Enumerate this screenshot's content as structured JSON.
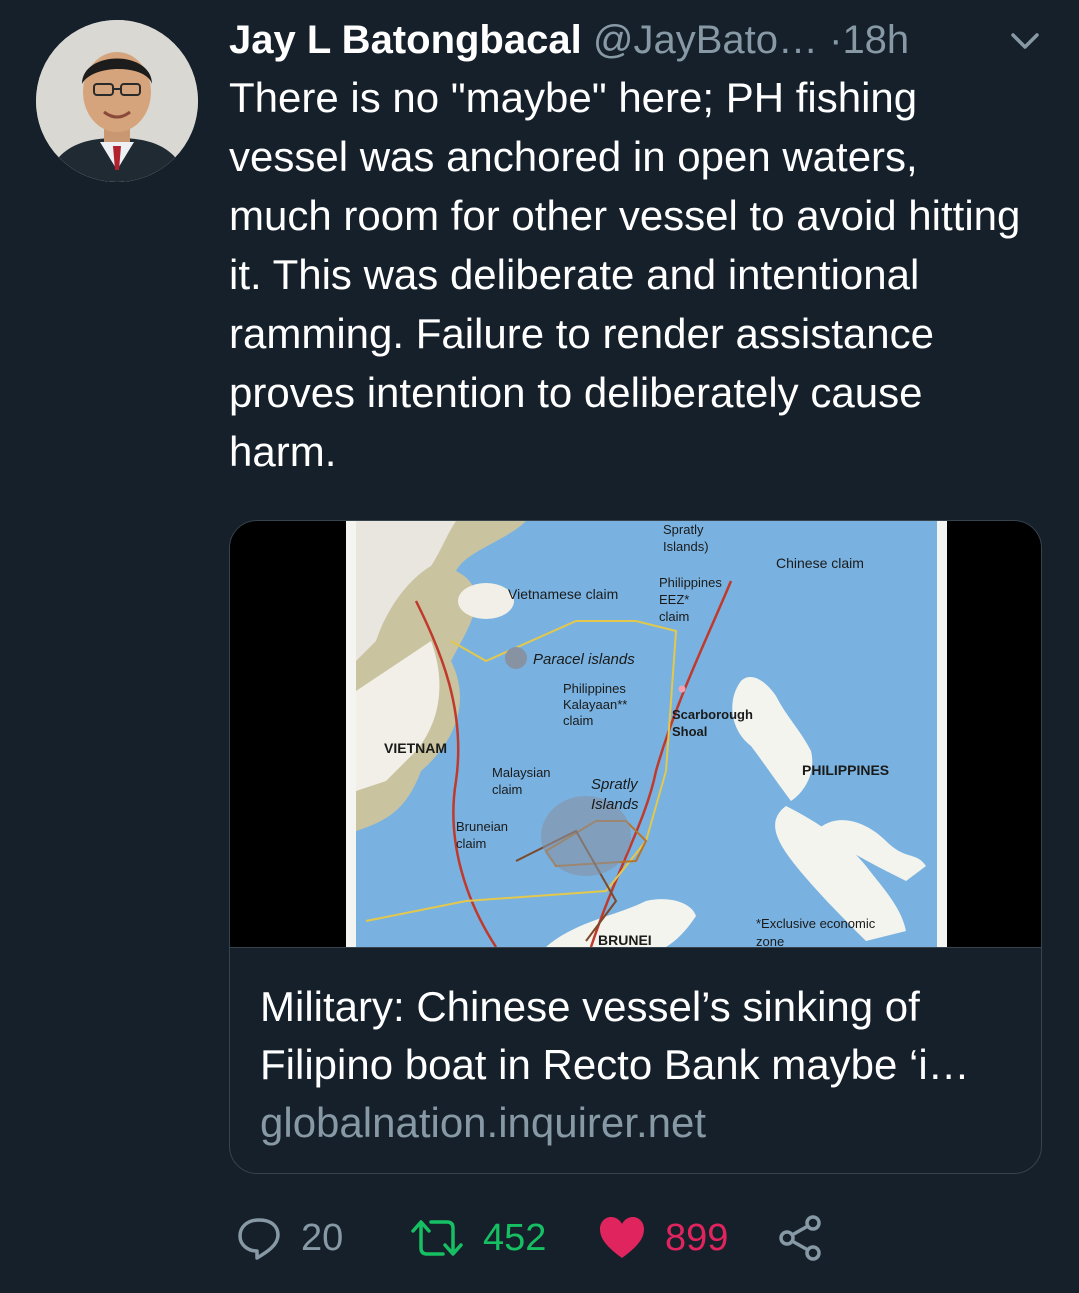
{
  "tweet": {
    "author_name": "Jay L Batongbacal",
    "author_handle": "@JayBato…",
    "separator": "·",
    "time": "18h",
    "text": "There is no \"maybe\" here; PH fishing vessel was anchored in open waters, much room for other vessel to avoid hitting it. This was deliberate and intentional ramming. Failure to render assistance proves intention to deliberately cause harm."
  },
  "card": {
    "title": "Military: Chinese vessel’s sinking of Filipino boat in Recto Bank maybe ‘i…",
    "domain": "globalnation.inquirer.net",
    "map": {
      "spratly_top": "Spratly\nIslands)",
      "chinese_claim": "Chinese claim",
      "vietnamese_claim": "Vietnamese claim",
      "philippines_eez": "Philippines\nEEZ*\nclaim",
      "paracel": "Paracel islands",
      "kalayaan": "Philippines\nKalayaan**\nclaim",
      "scarborough": "Scarborough\nShoal",
      "vietnam": "VIETNAM",
      "malaysian_claim": "Malaysian\nclaim",
      "spratly": "Spratly\nIslands",
      "philippines": "PHILIPPINES",
      "bruneian_claim": "Bruneian\nclaim",
      "brunei": "BRUNEI",
      "eez_note": "*Exclusive economic\nzone"
    }
  },
  "actions": {
    "replies": "20",
    "retweets": "452",
    "likes": "899"
  },
  "colors": {
    "background": "#15202b",
    "secondary_text": "#8899a6",
    "retweet_green": "#17bf63",
    "like_red": "#e0245e",
    "sea": "#79b2e0",
    "land": "#f2f2ee"
  }
}
